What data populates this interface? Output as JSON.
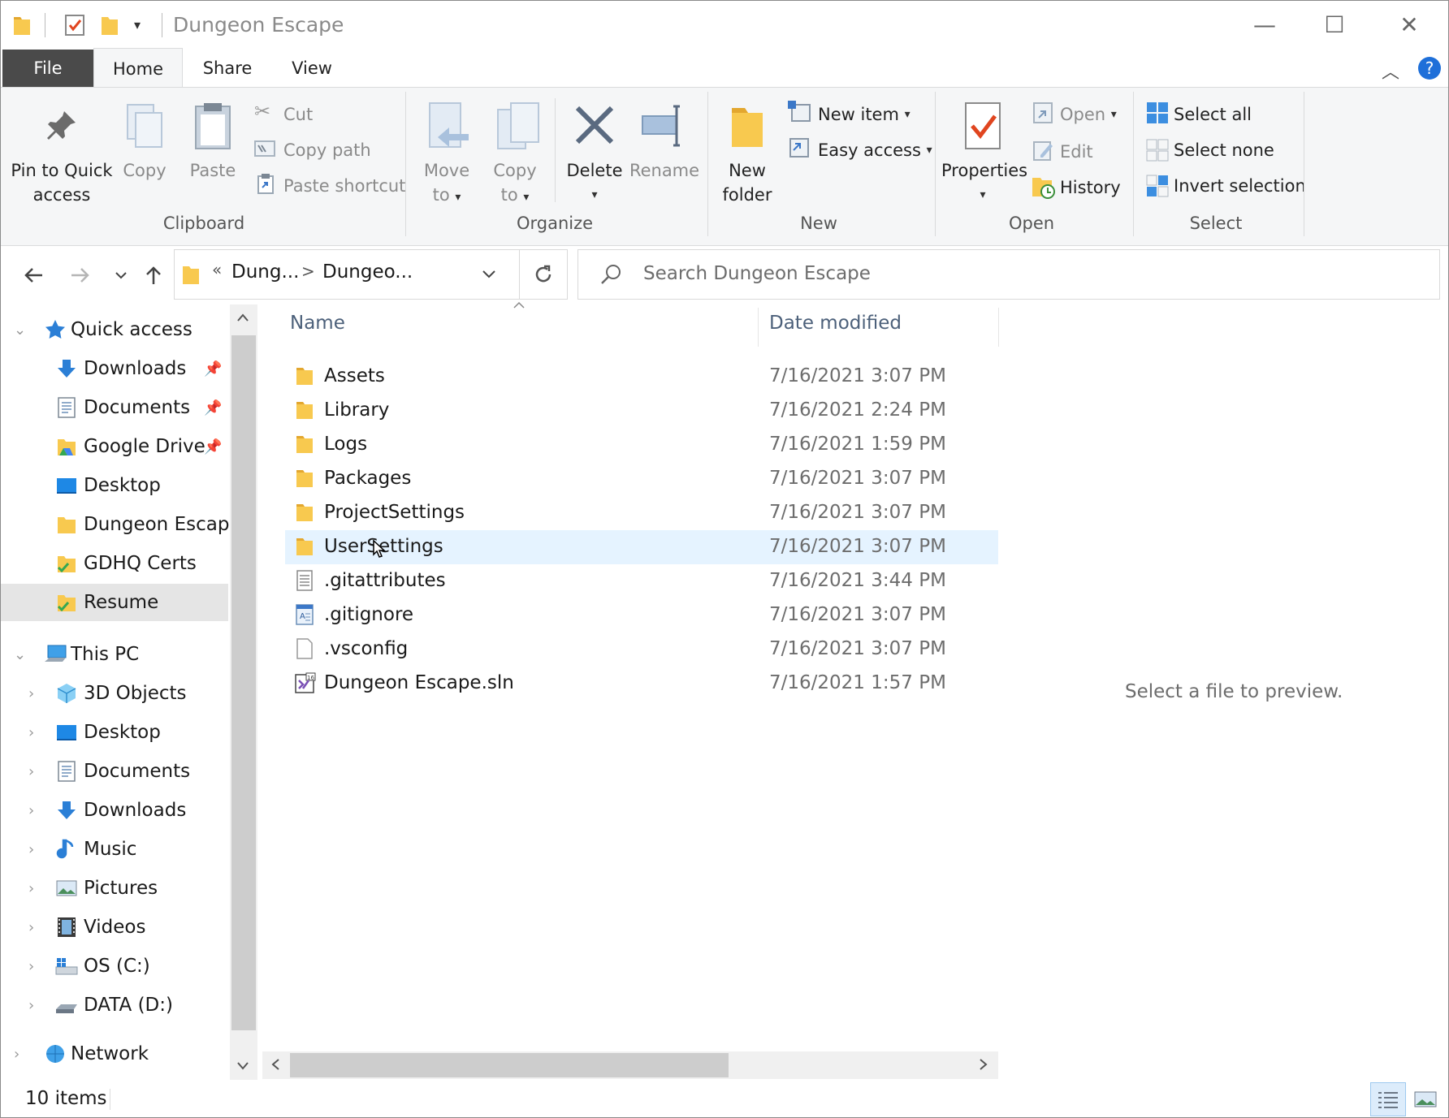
{
  "window": {
    "title": "Dungeon Escape",
    "controls": {
      "minimize": "—",
      "maximize": "☐",
      "close": "✕"
    }
  },
  "ribbon_tabs": [
    "File",
    "Home",
    "Share",
    "View"
  ],
  "ribbon": {
    "clipboard": {
      "label": "Clipboard",
      "pin_line1": "Pin to Quick",
      "pin_line2": "access",
      "copy": "Copy",
      "paste": "Paste",
      "cut": "Cut",
      "copy_path": "Copy path",
      "paste_shortcut": "Paste shortcut"
    },
    "organize": {
      "label": "Organize",
      "move_line1": "Move",
      "move_line2": "to",
      "copy_line1": "Copy",
      "copy_line2": "to",
      "delete": "Delete",
      "rename": "Rename"
    },
    "new": {
      "label": "New",
      "new_folder_line1": "New",
      "new_folder_line2": "folder",
      "new_item": "New item",
      "easy_access": "Easy access"
    },
    "open": {
      "label": "Open",
      "properties": "Properties",
      "open": "Open",
      "edit": "Edit",
      "history": "History"
    },
    "select": {
      "label": "Select",
      "select_all": "Select all",
      "select_none": "Select none",
      "invert_selection": "Invert selection"
    }
  },
  "address": {
    "overflow": "«",
    "crumb1": "Dung...",
    "crumb2": "Dungeo...",
    "separator": ">"
  },
  "search": {
    "placeholder": "Search Dungeon Escape"
  },
  "nav": {
    "quick_access": "Quick access",
    "quick_items": [
      {
        "label": "Downloads",
        "pinned": true
      },
      {
        "label": "Documents",
        "pinned": true
      },
      {
        "label": "Google Drive",
        "pinned": true
      },
      {
        "label": "Desktop",
        "pinned": false
      },
      {
        "label": "Dungeon Escape",
        "pinned": false
      },
      {
        "label": "GDHQ Certs",
        "pinned": false
      },
      {
        "label": "Resume",
        "pinned": false
      }
    ],
    "this_pc": "This PC",
    "pc_items": [
      "3D Objects",
      "Desktop",
      "Documents",
      "Downloads",
      "Music",
      "Pictures",
      "Videos",
      "OS (C:)",
      "DATA (D:)"
    ],
    "network": "Network"
  },
  "columns": {
    "name": "Name",
    "date": "Date modified"
  },
  "files": [
    {
      "name": "Assets",
      "date": "7/16/2021 3:07 PM",
      "kind": "folder"
    },
    {
      "name": "Library",
      "date": "7/16/2021 2:24 PM",
      "kind": "folder"
    },
    {
      "name": "Logs",
      "date": "7/16/2021 1:59 PM",
      "kind": "folder"
    },
    {
      "name": "Packages",
      "date": "7/16/2021 3:07 PM",
      "kind": "folder"
    },
    {
      "name": "ProjectSettings",
      "date": "7/16/2021 3:07 PM",
      "kind": "folder"
    },
    {
      "name": "UserSettings",
      "date": "7/16/2021 3:07 PM",
      "kind": "folder",
      "hovered": true
    },
    {
      "name": ".gitattributes",
      "date": "7/16/2021 3:44 PM",
      "kind": "text"
    },
    {
      "name": ".gitignore",
      "date": "7/16/2021 3:07 PM",
      "kind": "script"
    },
    {
      "name": ".vsconfig",
      "date": "7/16/2021 3:07 PM",
      "kind": "blank"
    },
    {
      "name": "Dungeon Escape.sln",
      "date": "7/16/2021 1:57 PM",
      "kind": "sln"
    }
  ],
  "preview": {
    "text": "Select a file to preview."
  },
  "status": {
    "items": "10 items"
  },
  "colors": {
    "accent": "#0078d7",
    "folder": "#f8c94f",
    "selection": "#e5f3ff"
  }
}
